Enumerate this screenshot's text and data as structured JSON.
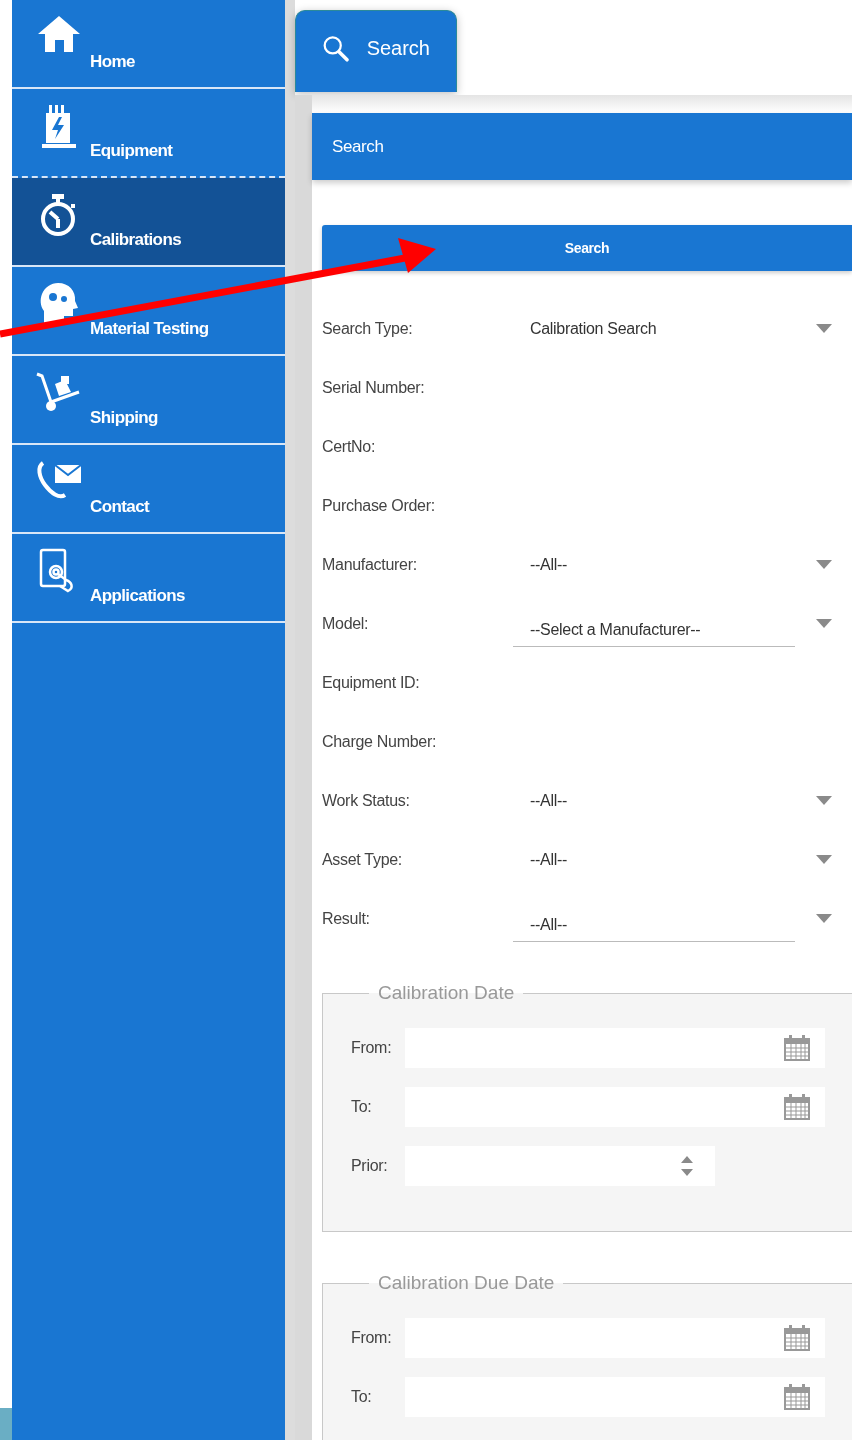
{
  "sidebar": {
    "items": [
      {
        "label": "Home",
        "selected": false,
        "dashed_divider": false
      },
      {
        "label": "Equipment",
        "selected": false,
        "dashed_divider": true
      },
      {
        "label": "Calibrations",
        "selected": true,
        "dashed_divider": false
      },
      {
        "label": "Material Testing",
        "selected": false,
        "dashed_divider": false
      },
      {
        "label": "Shipping",
        "selected": false,
        "dashed_divider": false
      },
      {
        "label": "Contact",
        "selected": false,
        "dashed_divider": false
      },
      {
        "label": "Applications",
        "selected": false,
        "dashed_divider": false
      }
    ]
  },
  "tabs": [
    {
      "label": "Search",
      "selected": true
    }
  ],
  "panel": {
    "title": "Search",
    "search_button": "Search",
    "fields": [
      {
        "label": "Search Type:",
        "kind": "select",
        "value": "Calibration Search",
        "underlined": false
      },
      {
        "label": "Serial Number:",
        "kind": "text"
      },
      {
        "label": "CertNo:",
        "kind": "text"
      },
      {
        "label": "Purchase Order:",
        "kind": "text"
      },
      {
        "label": "Manufacturer:",
        "kind": "select",
        "value": "--All--",
        "underlined": false
      },
      {
        "label": "Model:",
        "kind": "select",
        "value": "--Select a Manufacturer--",
        "underlined": true
      },
      {
        "label": "Equipment ID:",
        "kind": "text"
      },
      {
        "label": "Charge Number:",
        "kind": "text"
      },
      {
        "label": "Work Status:",
        "kind": "select",
        "value": "--All--",
        "underlined": false
      },
      {
        "label": "Asset Type:",
        "kind": "select",
        "value": "--All--",
        "underlined": false
      },
      {
        "label": "Result:",
        "kind": "select",
        "value": "--All--",
        "underlined": true
      }
    ]
  },
  "fieldsets": [
    {
      "legend": "Calibration Date",
      "rows": [
        {
          "label": "From:",
          "kind": "date"
        },
        {
          "label": "To:",
          "kind": "date"
        },
        {
          "label": "Prior:",
          "kind": "number"
        }
      ]
    },
    {
      "legend": "Calibration Due Date",
      "rows": [
        {
          "label": "From:",
          "kind": "date"
        },
        {
          "label": "To:",
          "kind": "date"
        }
      ]
    }
  ]
}
